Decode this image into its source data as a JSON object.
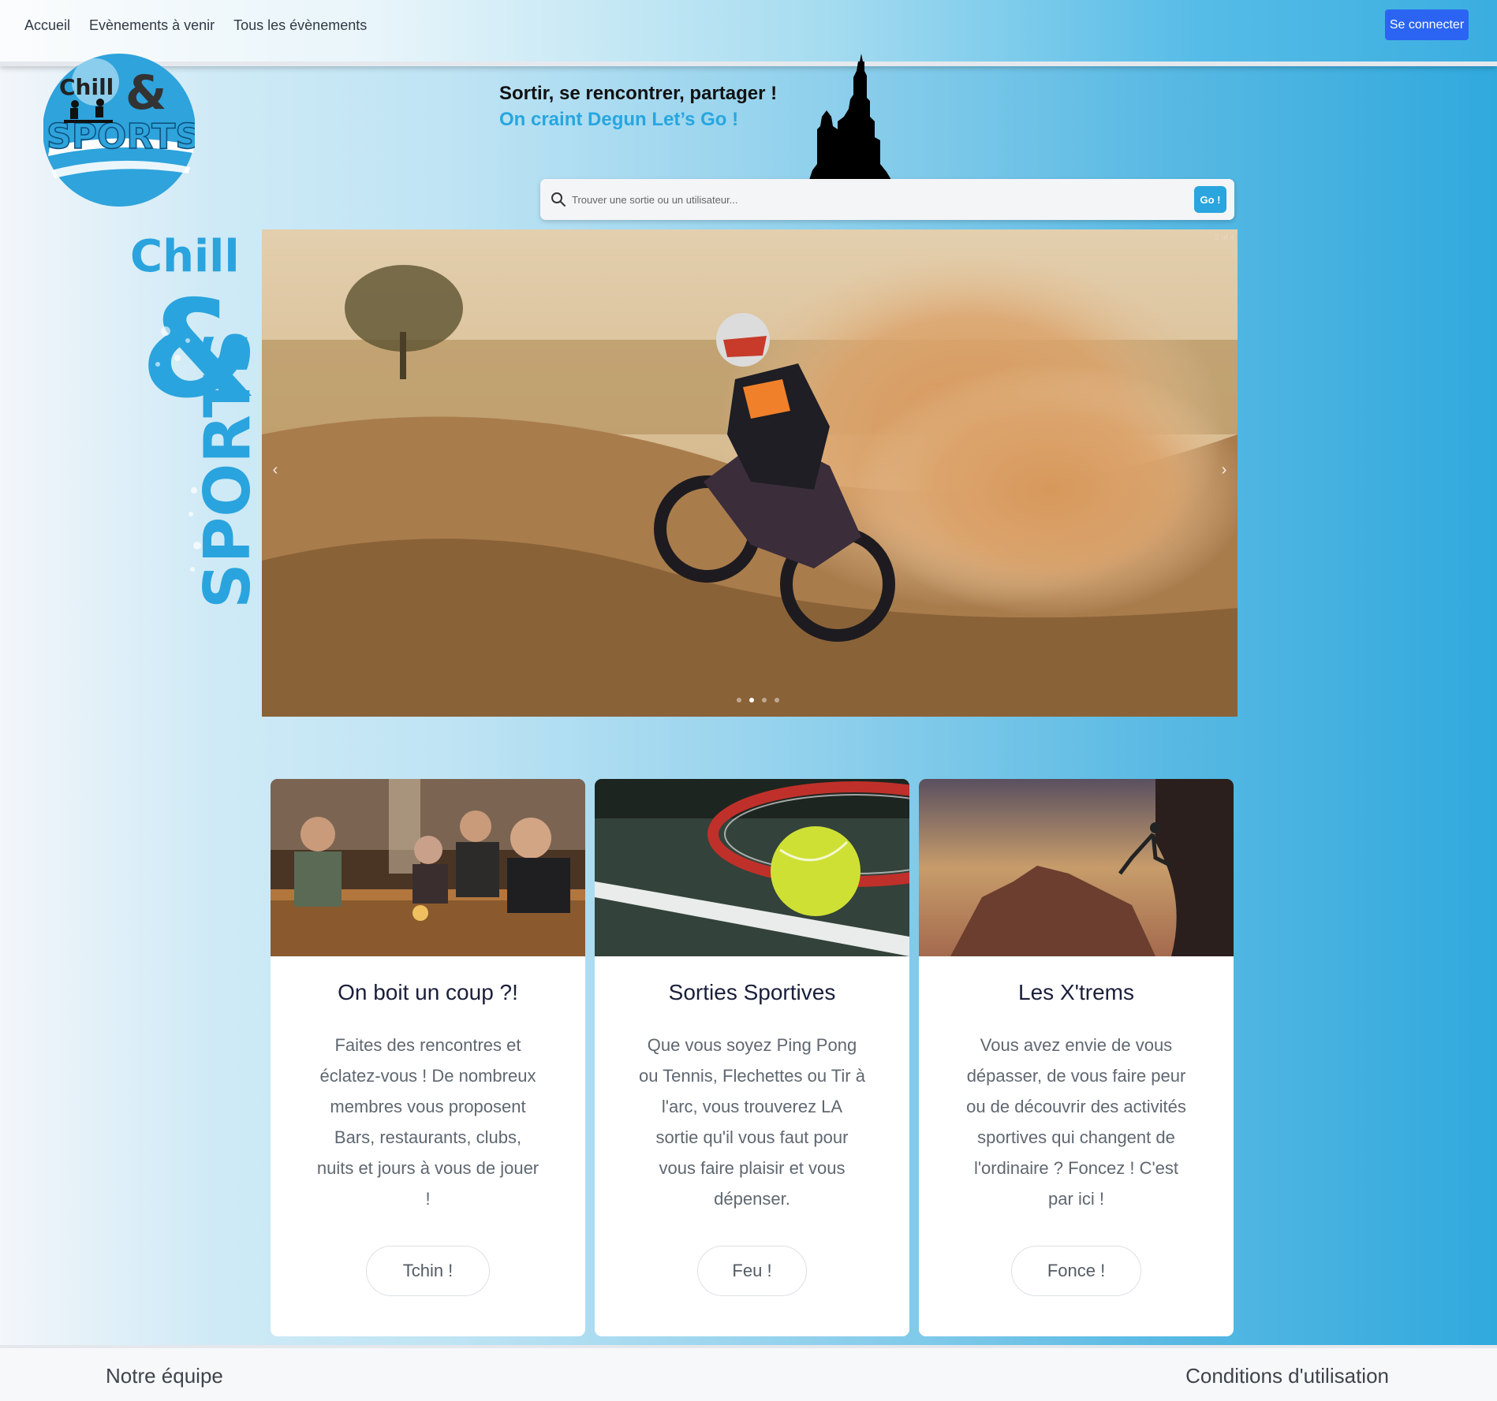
{
  "nav": {
    "links": [
      "Accueil",
      "Evènements à venir",
      "Tous les évènements"
    ],
    "login_label": "Se connecter"
  },
  "logo": {
    "line1": "Chill",
    "amp": "&",
    "line2": "SPORTS"
  },
  "hero": {
    "slogan_line1": "Sortir, se rencontrer, partager !",
    "slogan_line2": "On craint Degun Let’s Go !"
  },
  "search": {
    "placeholder": "Trouver une sortie ou un utilisateur...",
    "value": "",
    "go_label": "Go !"
  },
  "carousel": {
    "counter": "2 of 4",
    "current_slide": 2,
    "total_slides": 4,
    "prev_icon": "chevron-left-icon",
    "next_icon": "chevron-right-icon"
  },
  "cards": [
    {
      "title": "On boit un coup ?!",
      "text": "Faites des rencontres et éclatez-vous ! De nombreux membres vous proposent Bars, restaurants, clubs, nuits et jours à vous de jouer !",
      "button": "Tchin !"
    },
    {
      "title": "Sorties Sportives",
      "text": "Que vous soyez Ping Pong ou Tennis, Flechettes ou Tir à l'arc, vous trouverez LA sortie qu'il vous faut pour vous faire plaisir et vous dépenser.",
      "button": "Feu !"
    },
    {
      "title": "Les X'trems",
      "text": "Vous avez envie de vous dépasser, de vous faire peur ou de découvrir des activités sportives qui changent de l'ordinaire ? Foncez ! C'est par ici !",
      "button": "Fonce !"
    }
  ],
  "footer": {
    "left": "Notre équipe",
    "right": "Conditions d'utilisation"
  },
  "colors": {
    "accent": "#27a6e0",
    "login_button": "#2b64f2",
    "go_button": "#2aa5de"
  }
}
